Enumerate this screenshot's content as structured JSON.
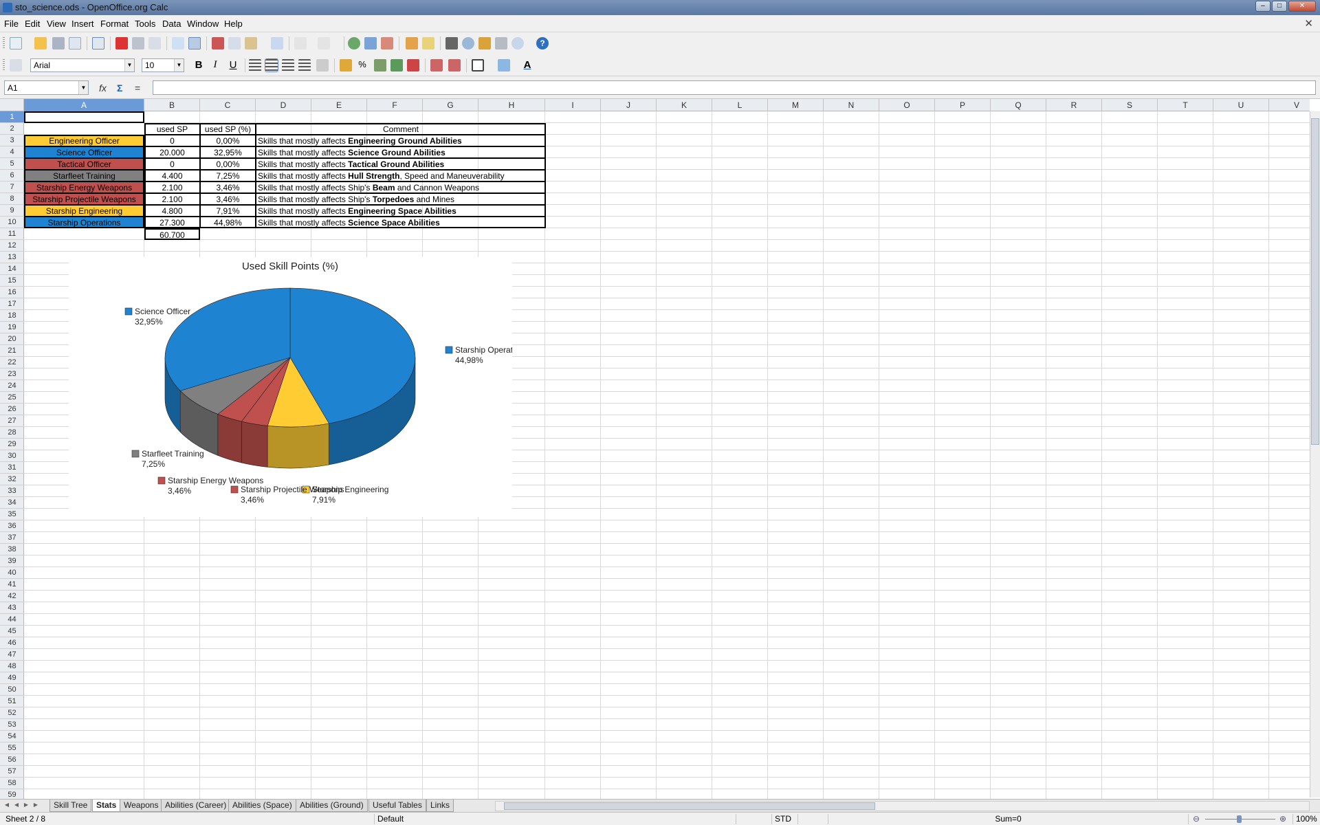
{
  "window": {
    "title": "sto_science.ods - OpenOffice.org Calc"
  },
  "menu": [
    "File",
    "Edit",
    "View",
    "Insert",
    "Format",
    "Tools",
    "Data",
    "Window",
    "Help"
  ],
  "toolbar": {
    "font_name": "Arial",
    "font_size": "10",
    "bold": "B",
    "italic": "I",
    "underline": "U"
  },
  "formula_bar": {
    "cell_ref": "A1",
    "formula": "",
    "fx": "fx",
    "sum": "Σ",
    "equals": "="
  },
  "columns": [
    "A",
    "B",
    "C",
    "D",
    "E",
    "F",
    "G",
    "H",
    "I",
    "J",
    "K",
    "L",
    "M",
    "N",
    "O",
    "P",
    "Q",
    "R",
    "S",
    "T",
    "U",
    "V"
  ],
  "table": {
    "headers": {
      "used_sp": "used SP",
      "used_sp_pct": "used SP (%)",
      "comment": "Comment"
    },
    "rows": [
      {
        "name": "Engineering Officer",
        "color": "#ffcc33",
        "sp": "0",
        "pct": "0,00%",
        "comment_pre": "Skills that mostly affects ",
        "comment_bold": "Engineering Ground Abilities",
        "comment_post": ""
      },
      {
        "name": "Science Officer",
        "color": "#1e83d1",
        "sp": "20.000",
        "pct": "32,95%",
        "comment_pre": "Skills that mostly affects ",
        "comment_bold": "Science Ground Abilities",
        "comment_post": ""
      },
      {
        "name": "Tactical Officer",
        "color": "#c0504d",
        "sp": "0",
        "pct": "0,00%",
        "comment_pre": "Skills that mostly affects ",
        "comment_bold": "Tactical Ground Abilities",
        "comment_post": ""
      },
      {
        "name": "Starfleet Training",
        "color": "#808080",
        "sp": "4.400",
        "pct": "7,25%",
        "comment_pre": "Skills that mostly affects ",
        "comment_bold": "Hull Strength",
        "comment_post": ", Speed and Maneuverability"
      },
      {
        "name": "Starship Energy Weapons",
        "color": "#c0504d",
        "sp": "2.100",
        "pct": "3,46%",
        "comment_pre": "Skills that mostly affects Ship's ",
        "comment_bold": "Beam",
        "comment_post": " and Cannon Weapons"
      },
      {
        "name": "Starship Projectile Weapons",
        "color": "#c0504d",
        "sp": "2.100",
        "pct": "3,46%",
        "comment_pre": "Skills that mostly affects Ship's ",
        "comment_bold": "Torpedoes",
        "comment_post": " and Mines"
      },
      {
        "name": "Starship Engineering",
        "color": "#ffcc33",
        "sp": "4.800",
        "pct": "7,91%",
        "comment_pre": "Skills that mostly affects ",
        "comment_bold": "Engineering Space Abilities",
        "comment_post": ""
      },
      {
        "name": "Starship Operations",
        "color": "#1e83d1",
        "sp": "27.300",
        "pct": "44,98%",
        "comment_pre": "Skills that mostly affects ",
        "comment_bold": "Science Space Abilities",
        "comment_post": ""
      }
    ],
    "total_sp": "60.700"
  },
  "chart_data": {
    "type": "pie",
    "title": "Used Skill Points (%)",
    "categories": [
      "Starship Operations",
      "Starship Engineering",
      "Starship Projectile Weapons",
      "Starship Energy Weapons",
      "Starfleet Training",
      "Science Officer"
    ],
    "values": [
      44.98,
      7.91,
      3.46,
      3.46,
      7.25,
      32.95
    ],
    "labels": [
      "44,98%",
      "7,91%",
      "3,46%",
      "3,46%",
      "7,25%",
      "32,95%"
    ],
    "colors": [
      "#1e83d1",
      "#ffcc33",
      "#c0504d",
      "#c0504d",
      "#808080",
      "#1e83d1"
    ],
    "style": "3d"
  },
  "sheet_tabs": [
    "Skill Tree",
    "Stats",
    "Weapons",
    "Abilities (Career)",
    "Abilities (Space)",
    "Abilities (Ground)",
    "Useful Tables",
    "Links"
  ],
  "active_tab": "Stats",
  "status": {
    "sheet": "Sheet 2 / 8",
    "page_style": "Default",
    "mode": "STD",
    "sum": "Sum=0",
    "zoom": "100%"
  }
}
